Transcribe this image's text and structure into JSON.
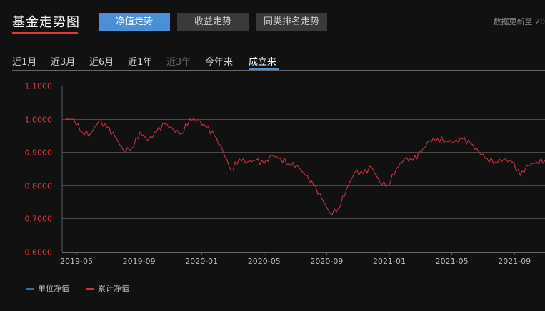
{
  "header": {
    "title": "基金走势图",
    "tabs": [
      {
        "label": "净值走势",
        "active": true
      },
      {
        "label": "收益走势",
        "active": false
      },
      {
        "label": "同类排名走势",
        "active": false
      }
    ],
    "update_text": "数据更新至 20"
  },
  "ranges": [
    {
      "label": "近1月",
      "state": "normal"
    },
    {
      "label": "近3月",
      "state": "normal"
    },
    {
      "label": "近6月",
      "state": "normal"
    },
    {
      "label": "近1年",
      "state": "normal"
    },
    {
      "label": "近3年",
      "state": "disabled"
    },
    {
      "label": "今年来",
      "state": "normal"
    },
    {
      "label": "成立来",
      "state": "active"
    }
  ],
  "colors": {
    "accent": "#4a90d9",
    "line_cumulative": "#c7333f",
    "line_unit": "#3b6ea5",
    "axis_label": "#e03a3a"
  },
  "chart_data": {
    "type": "line",
    "x_tick_labels": [
      "2019-05",
      "2019-09",
      "2020-01",
      "2020-05",
      "2020-09",
      "2021-01",
      "2021-05",
      "2021-09"
    ],
    "y_tick_labels": [
      "1.1000",
      "1.0000",
      "0.9000",
      "0.8000",
      "0.7000",
      "0.6000"
    ],
    "ylim": [
      0.6,
      1.1
    ],
    "grid": true,
    "legend": {
      "position": "bottom-left",
      "entries": [
        "单位净值",
        "累计净值"
      ]
    },
    "series": [
      {
        "name": "累计净值",
        "x": [
          "2019-05",
          "2019-06",
          "2019-06",
          "2019-07",
          "2019-07",
          "2019-08",
          "2019-08",
          "2019-09",
          "2019-09",
          "2019-10",
          "2019-10",
          "2019-11",
          "2019-11",
          "2019-12",
          "2019-12",
          "2020-01",
          "2020-01",
          "2020-02",
          "2020-02",
          "2020-03",
          "2020-03",
          "2020-04",
          "2020-04",
          "2020-05",
          "2020-05",
          "2020-06",
          "2020-06",
          "2020-07",
          "2020-07",
          "2020-08",
          "2020-08",
          "2020-09",
          "2020-09",
          "2020-10",
          "2020-10",
          "2020-11",
          "2020-11",
          "2020-12",
          "2020-12",
          "2021-01",
          "2021-01",
          "2021-02",
          "2021-02",
          "2021-03",
          "2021-03",
          "2021-04",
          "2021-04",
          "2021-05",
          "2021-05",
          "2021-06",
          "2021-06",
          "2021-07",
          "2021-07",
          "2021-08",
          "2021-08",
          "2021-09",
          "2021-09",
          "2021-10",
          "2021-10"
        ],
        "y": [
          1.0,
          0.998,
          0.96,
          0.955,
          0.993,
          0.975,
          0.945,
          0.905,
          0.912,
          0.96,
          0.935,
          0.962,
          0.985,
          0.968,
          0.955,
          1.0,
          0.995,
          0.975,
          0.95,
          0.905,
          0.845,
          0.88,
          0.87,
          0.875,
          0.865,
          0.89,
          0.88,
          0.865,
          0.86,
          0.83,
          0.8,
          0.76,
          0.715,
          0.73,
          0.79,
          0.84,
          0.835,
          0.855,
          0.81,
          0.8,
          0.85,
          0.88,
          0.875,
          0.9,
          0.935,
          0.94,
          0.935,
          0.93,
          0.94,
          0.925,
          0.9,
          0.88,
          0.87,
          0.878,
          0.87,
          0.83,
          0.86,
          0.87,
          0.875
        ]
      },
      {
        "name": "单位净值",
        "x": [],
        "y": []
      }
    ]
  }
}
